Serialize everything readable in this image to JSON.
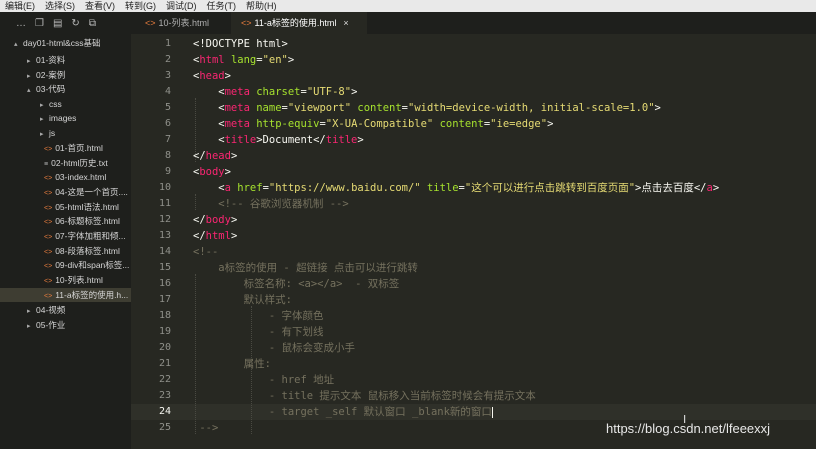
{
  "menubar": {
    "items": [
      "编辑(E)",
      "选择(S)",
      "查看(V)",
      "转到(G)",
      "调试(D)",
      "任务(T)",
      "帮助(H)"
    ]
  },
  "sidebar": {
    "toolbar_icons": [
      "more-icon",
      "new-file-icon",
      "new-folder-icon",
      "refresh-icon",
      "collapse-icon"
    ],
    "tree": [
      {
        "label": "day01-html&css基础",
        "twisty": "▴"
      },
      {
        "label": "01-资料",
        "twisty": "▸"
      },
      {
        "label": "02-案例",
        "twisty": "▸"
      },
      {
        "label": "03-代码",
        "twisty": "▴"
      },
      {
        "label": "css",
        "twisty": "▸"
      },
      {
        "label": "images",
        "twisty": "▸"
      },
      {
        "label": "js",
        "twisty": "▸"
      },
      {
        "label": "01-首页.html",
        "icon": "<>"
      },
      {
        "label": "02-html历史.txt",
        "icon": "≡"
      },
      {
        "label": "03-index.html",
        "icon": "<>"
      },
      {
        "label": "04-这是一个首页....",
        "icon": "<>"
      },
      {
        "label": "05-html语法.html",
        "icon": "<>"
      },
      {
        "label": "06-标题标签.html",
        "icon": "<>"
      },
      {
        "label": "07-字体加粗和倾...",
        "icon": "<>"
      },
      {
        "label": "08-段落标签.html",
        "icon": "<>"
      },
      {
        "label": "09-div和span标签...",
        "icon": "<>"
      },
      {
        "label": "10-列表.html",
        "icon": "<>"
      },
      {
        "label": "11-a标签的使用.h...",
        "icon": "<>",
        "selected": true
      },
      {
        "label": "04-视频",
        "twisty": "▸"
      },
      {
        "label": "05-作业",
        "twisty": "▸"
      }
    ]
  },
  "tabs": [
    {
      "label": "10-列表.html",
      "active": false
    },
    {
      "label": "11-a标签的使用.html",
      "active": true,
      "close": "×"
    }
  ],
  "editor": {
    "active_line": 24,
    "line_numbers": [
      "1",
      "2",
      "3",
      "4",
      "5",
      "6",
      "7",
      "8",
      "9",
      "10",
      "11",
      "12",
      "13",
      "14",
      "15",
      "16",
      "17",
      "18",
      "19",
      "20",
      "21",
      "22",
      "23",
      "24",
      "25"
    ],
    "lines": [
      [
        [
          "p",
          "<!DOCTYPE html>"
        ]
      ],
      [
        [
          "p",
          "<"
        ],
        [
          "t",
          "html"
        ],
        [
          "p",
          " "
        ],
        [
          "a",
          "lang"
        ],
        [
          "p",
          "="
        ],
        [
          "s",
          "\"en\""
        ],
        [
          "p",
          ">"
        ]
      ],
      [
        [
          "p",
          "<"
        ],
        [
          "t",
          "head"
        ],
        [
          "p",
          ">"
        ]
      ],
      [
        [
          "p",
          "    <"
        ],
        [
          "t",
          "meta"
        ],
        [
          "p",
          " "
        ],
        [
          "a",
          "charset"
        ],
        [
          "p",
          "="
        ],
        [
          "s",
          "\"UTF-8\""
        ],
        [
          "p",
          ">"
        ]
      ],
      [
        [
          "p",
          "    <"
        ],
        [
          "t",
          "meta"
        ],
        [
          "p",
          " "
        ],
        [
          "a",
          "name"
        ],
        [
          "p",
          "="
        ],
        [
          "s",
          "\"viewport\""
        ],
        [
          "p",
          " "
        ],
        [
          "a",
          "content"
        ],
        [
          "p",
          "="
        ],
        [
          "s",
          "\"width=device-width, initial-scale=1.0\""
        ],
        [
          "p",
          ">"
        ]
      ],
      [
        [
          "p",
          "    <"
        ],
        [
          "t",
          "meta"
        ],
        [
          "p",
          " "
        ],
        [
          "a",
          "http-equiv"
        ],
        [
          "p",
          "="
        ],
        [
          "s",
          "\"X-UA-Compatible\""
        ],
        [
          "p",
          " "
        ],
        [
          "a",
          "content"
        ],
        [
          "p",
          "="
        ],
        [
          "s",
          "\"ie=edge\""
        ],
        [
          "p",
          ">"
        ]
      ],
      [
        [
          "p",
          "    <"
        ],
        [
          "t",
          "title"
        ],
        [
          "p",
          ">Document</"
        ],
        [
          "t",
          "title"
        ],
        [
          "p",
          ">"
        ]
      ],
      [
        [
          "p",
          "</"
        ],
        [
          "t",
          "head"
        ],
        [
          "p",
          ">"
        ]
      ],
      [
        [
          "p",
          "<"
        ],
        [
          "t",
          "body"
        ],
        [
          "p",
          ">"
        ]
      ],
      [
        [
          "p",
          "    <"
        ],
        [
          "t",
          "a"
        ],
        [
          "p",
          " "
        ],
        [
          "a",
          "href"
        ],
        [
          "p",
          "="
        ],
        [
          "s",
          "\"https://www.baidu.com/\""
        ],
        [
          "p",
          " "
        ],
        [
          "a",
          "title"
        ],
        [
          "p",
          "="
        ],
        [
          "s",
          "\"这个可以进行点击跳转到百度页面\""
        ],
        [
          "p",
          ">点击去百度</"
        ],
        [
          "t",
          "a"
        ],
        [
          "p",
          ">"
        ]
      ],
      [
        [
          "c",
          "    <!-- 谷歌浏览器机制 -->"
        ]
      ],
      [
        [
          "p",
          "</"
        ],
        [
          "t",
          "body"
        ],
        [
          "p",
          ">"
        ]
      ],
      [
        [
          "p",
          "</"
        ],
        [
          "t",
          "html"
        ],
        [
          "p",
          ">"
        ]
      ],
      [
        [
          "c",
          "<!--"
        ]
      ],
      [
        [
          "c",
          "    a标签的使用 - 超链接 点击可以进行跳转"
        ]
      ],
      [
        [
          "c",
          "        标签名称: <a></a>  - 双标签"
        ]
      ],
      [
        [
          "c",
          "        默认样式:"
        ]
      ],
      [
        [
          "c",
          "            - 字体颜色"
        ]
      ],
      [
        [
          "c",
          "            - 有下划线"
        ]
      ],
      [
        [
          "c",
          "            - 鼠标会变成小手"
        ]
      ],
      [
        [
          "c",
          "        属性:"
        ]
      ],
      [
        [
          "c",
          "            - href 地址"
        ]
      ],
      [
        [
          "c",
          "            - title 提示文本 鼠标移入当前标签时候会有提示文本"
        ]
      ],
      [
        [
          "c",
          "            - target _self 默认窗口 _blank新的窗口"
        ]
      ],
      [
        [
          "c",
          " -->"
        ]
      ]
    ]
  },
  "watermark": "https://blog.csdn.net/lfeeexxj"
}
